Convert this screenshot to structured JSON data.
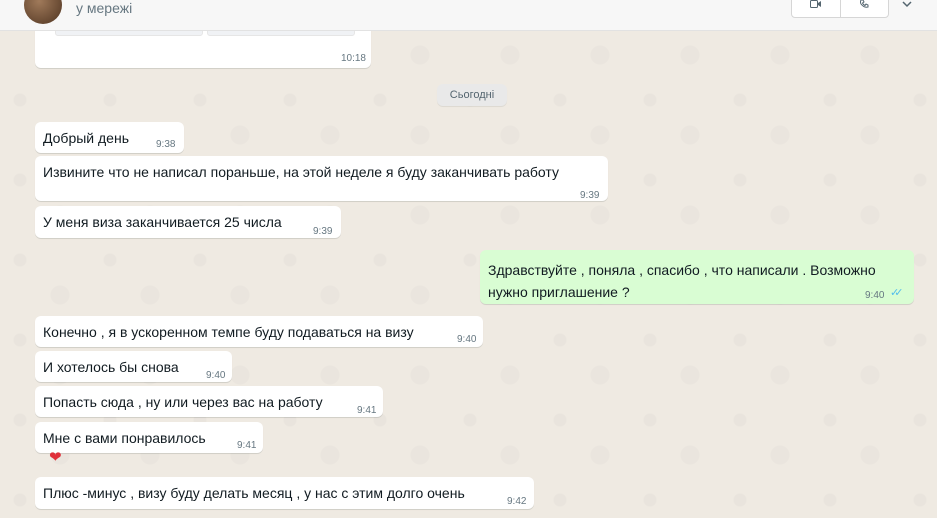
{
  "header": {
    "status": "у мережі",
    "video_call_icon": "video-call-icon",
    "voice_call_icon": "voice-call-icon",
    "chevron_icon": "chevron-down-icon"
  },
  "previous_message": {
    "time": "10:18"
  },
  "date_separator": "Сьогодні",
  "messages": [
    {
      "text": "Добрый день",
      "time": "9:38",
      "direction": "in"
    },
    {
      "text": "Извините что не написал пораньше, на этой неделе я буду заканчивать работу",
      "time": "9:39",
      "direction": "in"
    },
    {
      "text": "У меня виза заканчивается 25 числа",
      "time": "9:39",
      "direction": "in"
    },
    {
      "text": "Здравствуйте , поняла , спасибо , что написали . Возможно нужно приглашение ?",
      "time": "9:40",
      "direction": "out",
      "read": true
    },
    {
      "text": "Конечно , я в ускоренном темпе буду подаваться на визу",
      "time": "9:40",
      "direction": "in"
    },
    {
      "text": "И хотелось бы снова",
      "time": "9:40",
      "direction": "in"
    },
    {
      "text": "Попасть сюда , ну или через вас на работу",
      "time": "9:41",
      "direction": "in"
    },
    {
      "text": "Мне с вами понравилось",
      "time": "9:41",
      "direction": "in",
      "reaction": "❤"
    },
    {
      "text": "Плюс -минус , визу буду делать месяц , у нас с этим долго очень",
      "time": "9:42",
      "direction": "in"
    }
  ],
  "colors": {
    "chat_background": "#efeae2",
    "incoming_bubble": "#ffffff",
    "outgoing_bubble": "#d9fdd3",
    "read_ticks": "#53bdeb"
  }
}
